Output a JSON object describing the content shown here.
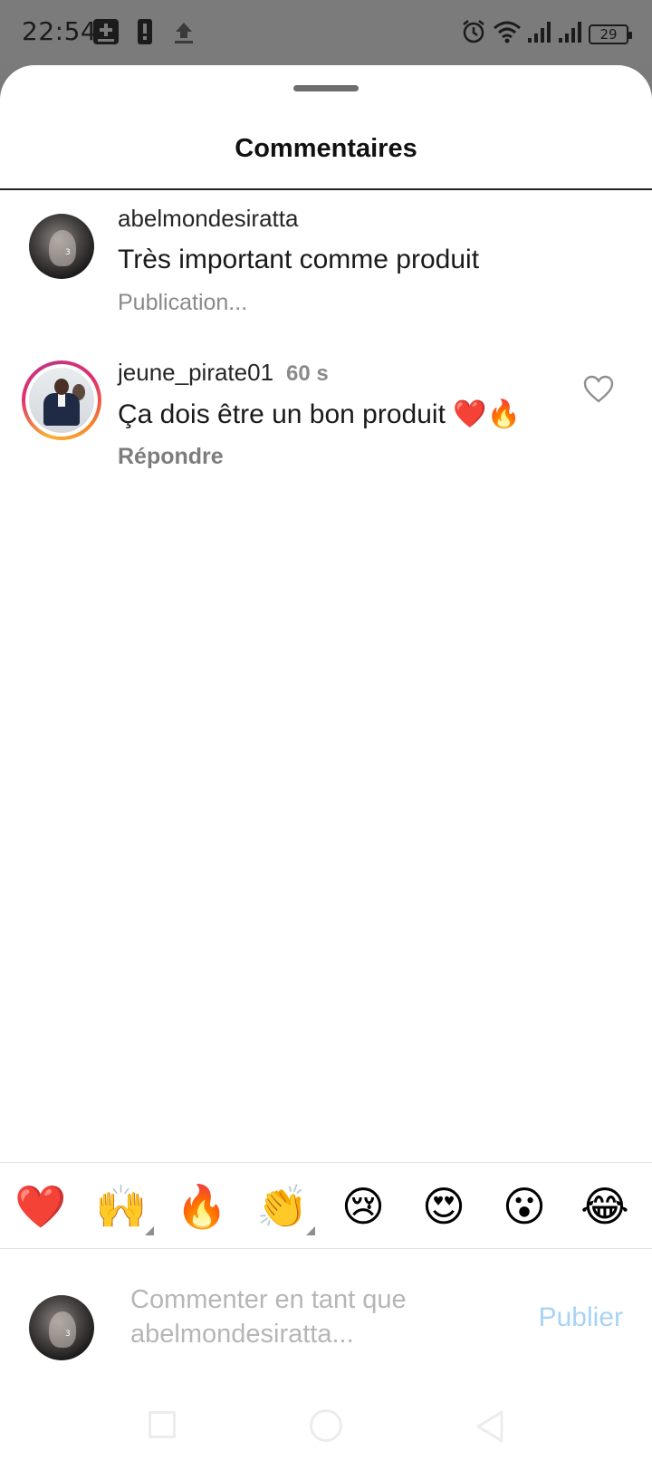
{
  "status_bar": {
    "time": "22:54",
    "battery": "29",
    "icons": [
      "add-box-icon",
      "vibrate-icon",
      "upload-icon",
      "alarm-icon",
      "wifi-icon",
      "signal-icon",
      "signal-icon",
      "battery-icon"
    ]
  },
  "sheet": {
    "title": "Commentaires"
  },
  "comments": [
    {
      "username": "abelmondesiratta",
      "text": "Très important comme produit",
      "meta": "Publication..."
    },
    {
      "username": "jeune_pirate01",
      "time": "60 s",
      "text": "Ça dois être un bon produit ❤️🔥",
      "reply_label": "Répondre"
    }
  ],
  "emoji_bar": {
    "emojis": [
      "❤️",
      "🙌",
      "🔥",
      "👏",
      "😢",
      "😍",
      "😮",
      "😂"
    ]
  },
  "composer": {
    "placeholder_line1": "Commenter en tant que",
    "placeholder_line2": "abelmondesiratta...",
    "publish_label": "Publier"
  },
  "colors": {
    "publish_disabled": "#a8d3f5",
    "story_ring": [
      "#f9b233",
      "#e1306c",
      "#c13584"
    ]
  }
}
